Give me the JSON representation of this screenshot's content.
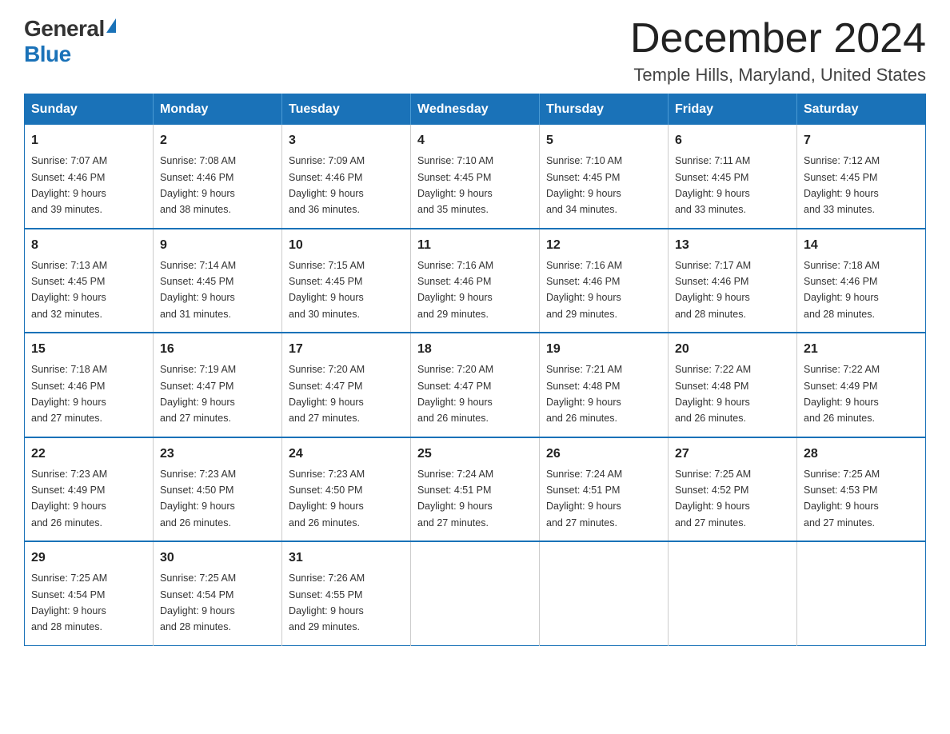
{
  "header": {
    "logo": {
      "general": "General",
      "blue": "Blue"
    },
    "title": "December 2024",
    "location": "Temple Hills, Maryland, United States"
  },
  "days_of_week": [
    "Sunday",
    "Monday",
    "Tuesday",
    "Wednesday",
    "Thursday",
    "Friday",
    "Saturday"
  ],
  "weeks": [
    [
      {
        "day": "1",
        "sunrise": "7:07 AM",
        "sunset": "4:46 PM",
        "daylight": "9 hours and 39 minutes."
      },
      {
        "day": "2",
        "sunrise": "7:08 AM",
        "sunset": "4:46 PM",
        "daylight": "9 hours and 38 minutes."
      },
      {
        "day": "3",
        "sunrise": "7:09 AM",
        "sunset": "4:46 PM",
        "daylight": "9 hours and 36 minutes."
      },
      {
        "day": "4",
        "sunrise": "7:10 AM",
        "sunset": "4:45 PM",
        "daylight": "9 hours and 35 minutes."
      },
      {
        "day": "5",
        "sunrise": "7:10 AM",
        "sunset": "4:45 PM",
        "daylight": "9 hours and 34 minutes."
      },
      {
        "day": "6",
        "sunrise": "7:11 AM",
        "sunset": "4:45 PM",
        "daylight": "9 hours and 33 minutes."
      },
      {
        "day": "7",
        "sunrise": "7:12 AM",
        "sunset": "4:45 PM",
        "daylight": "9 hours and 33 minutes."
      }
    ],
    [
      {
        "day": "8",
        "sunrise": "7:13 AM",
        "sunset": "4:45 PM",
        "daylight": "9 hours and 32 minutes."
      },
      {
        "day": "9",
        "sunrise": "7:14 AM",
        "sunset": "4:45 PM",
        "daylight": "9 hours and 31 minutes."
      },
      {
        "day": "10",
        "sunrise": "7:15 AM",
        "sunset": "4:45 PM",
        "daylight": "9 hours and 30 minutes."
      },
      {
        "day": "11",
        "sunrise": "7:16 AM",
        "sunset": "4:46 PM",
        "daylight": "9 hours and 29 minutes."
      },
      {
        "day": "12",
        "sunrise": "7:16 AM",
        "sunset": "4:46 PM",
        "daylight": "9 hours and 29 minutes."
      },
      {
        "day": "13",
        "sunrise": "7:17 AM",
        "sunset": "4:46 PM",
        "daylight": "9 hours and 28 minutes."
      },
      {
        "day": "14",
        "sunrise": "7:18 AM",
        "sunset": "4:46 PM",
        "daylight": "9 hours and 28 minutes."
      }
    ],
    [
      {
        "day": "15",
        "sunrise": "7:18 AM",
        "sunset": "4:46 PM",
        "daylight": "9 hours and 27 minutes."
      },
      {
        "day": "16",
        "sunrise": "7:19 AM",
        "sunset": "4:47 PM",
        "daylight": "9 hours and 27 minutes."
      },
      {
        "day": "17",
        "sunrise": "7:20 AM",
        "sunset": "4:47 PM",
        "daylight": "9 hours and 27 minutes."
      },
      {
        "day": "18",
        "sunrise": "7:20 AM",
        "sunset": "4:47 PM",
        "daylight": "9 hours and 26 minutes."
      },
      {
        "day": "19",
        "sunrise": "7:21 AM",
        "sunset": "4:48 PM",
        "daylight": "9 hours and 26 minutes."
      },
      {
        "day": "20",
        "sunrise": "7:22 AM",
        "sunset": "4:48 PM",
        "daylight": "9 hours and 26 minutes."
      },
      {
        "day": "21",
        "sunrise": "7:22 AM",
        "sunset": "4:49 PM",
        "daylight": "9 hours and 26 minutes."
      }
    ],
    [
      {
        "day": "22",
        "sunrise": "7:23 AM",
        "sunset": "4:49 PM",
        "daylight": "9 hours and 26 minutes."
      },
      {
        "day": "23",
        "sunrise": "7:23 AM",
        "sunset": "4:50 PM",
        "daylight": "9 hours and 26 minutes."
      },
      {
        "day": "24",
        "sunrise": "7:23 AM",
        "sunset": "4:50 PM",
        "daylight": "9 hours and 26 minutes."
      },
      {
        "day": "25",
        "sunrise": "7:24 AM",
        "sunset": "4:51 PM",
        "daylight": "9 hours and 27 minutes."
      },
      {
        "day": "26",
        "sunrise": "7:24 AM",
        "sunset": "4:51 PM",
        "daylight": "9 hours and 27 minutes."
      },
      {
        "day": "27",
        "sunrise": "7:25 AM",
        "sunset": "4:52 PM",
        "daylight": "9 hours and 27 minutes."
      },
      {
        "day": "28",
        "sunrise": "7:25 AM",
        "sunset": "4:53 PM",
        "daylight": "9 hours and 27 minutes."
      }
    ],
    [
      {
        "day": "29",
        "sunrise": "7:25 AM",
        "sunset": "4:54 PM",
        "daylight": "9 hours and 28 minutes."
      },
      {
        "day": "30",
        "sunrise": "7:25 AM",
        "sunset": "4:54 PM",
        "daylight": "9 hours and 28 minutes."
      },
      {
        "day": "31",
        "sunrise": "7:26 AM",
        "sunset": "4:55 PM",
        "daylight": "9 hours and 29 minutes."
      },
      null,
      null,
      null,
      null
    ]
  ],
  "labels": {
    "sunrise": "Sunrise:",
    "sunset": "Sunset:",
    "daylight": "Daylight:"
  }
}
